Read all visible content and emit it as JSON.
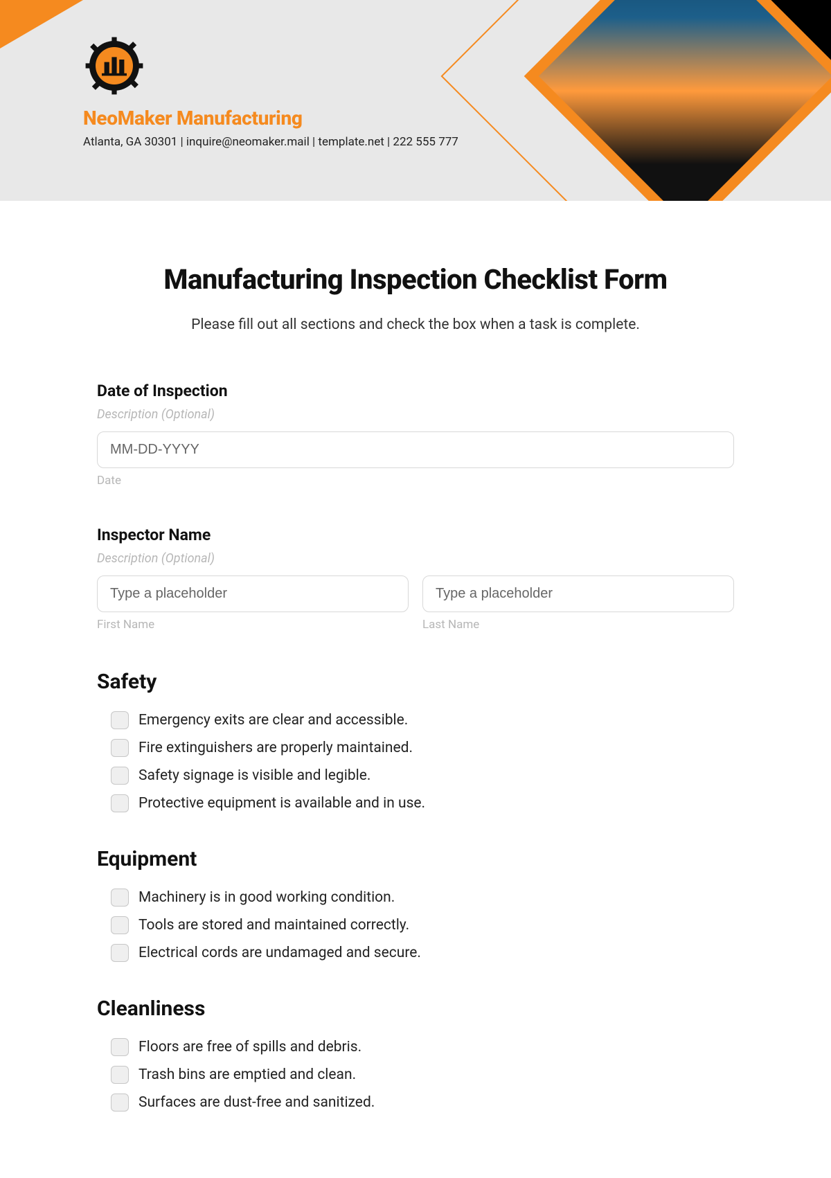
{
  "header": {
    "company_name": "NeoMaker Manufacturing",
    "meta": "Atlanta, GA 30301 | inquire@neomaker.mail | template.net | 222 555 777"
  },
  "form": {
    "title": "Manufacturing Inspection Checklist Form",
    "subtitle": "Please fill out all sections and check the box when a task is complete."
  },
  "date_field": {
    "label": "Date of Inspection",
    "desc": "Description (Optional)",
    "placeholder": "MM-DD-YYYY",
    "sublabel": "Date"
  },
  "name_field": {
    "label": "Inspector Name",
    "desc": "Description (Optional)",
    "first_placeholder": "Type a placeholder",
    "first_sublabel": "First Name",
    "last_placeholder": "Type a placeholder",
    "last_sublabel": "Last Name"
  },
  "sections": {
    "safety": {
      "title": "Safety",
      "items": [
        "Emergency exits are clear and accessible.",
        "Fire extinguishers are properly maintained.",
        "Safety signage is visible and legible.",
        "Protective equipment is available and in use."
      ]
    },
    "equipment": {
      "title": "Equipment",
      "items": [
        "Machinery is in good working condition.",
        "Tools are stored and maintained correctly.",
        "Electrical cords are undamaged and secure."
      ]
    },
    "cleanliness": {
      "title": "Cleanliness",
      "items": [
        "Floors are free of spills and debris.",
        "Trash bins are emptied and clean.",
        "Surfaces are dust-free and sanitized."
      ]
    }
  }
}
